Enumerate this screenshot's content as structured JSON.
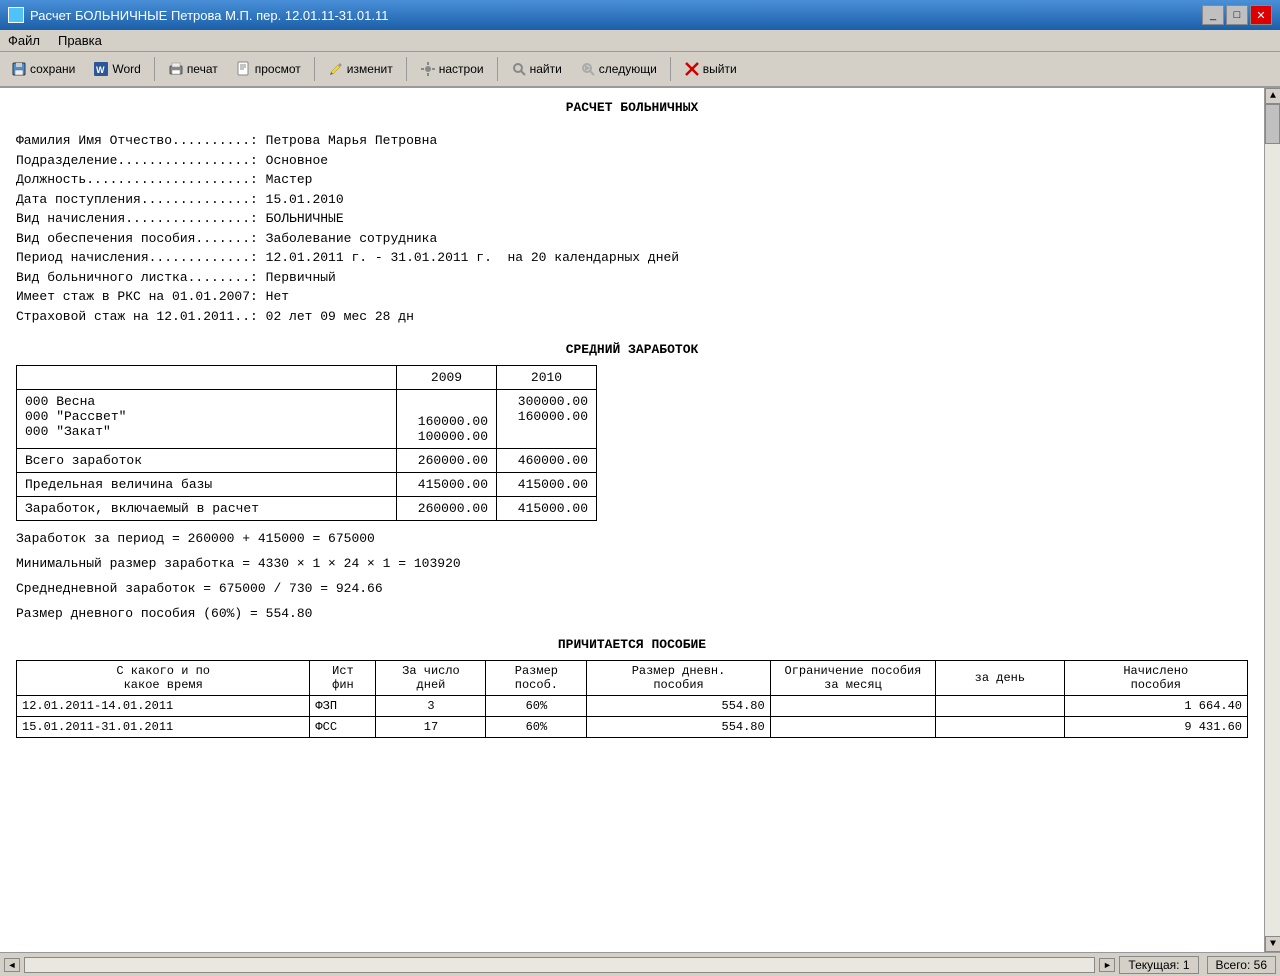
{
  "titleBar": {
    "title": "Расчет БОЛЬНИЧНЫЕ Петрова М.П. пер. 12.01.11-31.01.11",
    "icon": "app-icon"
  },
  "menuBar": {
    "items": [
      "Файл",
      "Правка"
    ]
  },
  "toolbar": {
    "buttons": [
      {
        "label": "сохрани",
        "icon": "save-icon"
      },
      {
        "label": "Word",
        "icon": "word-icon"
      },
      {
        "label": "печат",
        "icon": "print-icon"
      },
      {
        "label": "просмот",
        "icon": "preview-icon"
      },
      {
        "label": "изменит",
        "icon": "edit-icon"
      },
      {
        "label": "настрои",
        "icon": "settings-icon"
      },
      {
        "label": "найти",
        "icon": "find-icon"
      },
      {
        "label": "следующи",
        "icon": "next-icon"
      },
      {
        "label": "выйти",
        "icon": "exit-icon"
      }
    ]
  },
  "document": {
    "title": "РАСЧЕТ БОЛЬНИЧНЫХ",
    "infoLines": [
      {
        "label": "Фамилия Имя Отчество..........: ",
        "value": "Петрова Марья Петровна"
      },
      {
        "label": "Подразделение.................: ",
        "value": "Основное"
      },
      {
        "label": "Должность.....................: ",
        "value": "Мастер"
      },
      {
        "label": "Дата поступления..............: ",
        "value": "15.01.2010"
      },
      {
        "label": "Вид начисления................: ",
        "value": "БОЛЬНИЧНЫЕ"
      },
      {
        "label": "Вид обеспечения пособия.......: ",
        "value": "Заболевание сотрудника"
      },
      {
        "label": "Период начисления.............: ",
        "value": "12.01.2011 г. - 31.01.2011 г.  на 20 календарных дней"
      },
      {
        "label": "Вид больничного листка........: ",
        "value": "Первичный"
      },
      {
        "label": "Имеет стаж в РКС на 01.01.2007: ",
        "value": "Нет"
      },
      {
        "label": "Страховой стаж на 12.01.2011..: ",
        "value": "02 лет 09 мес 28 дн"
      }
    ],
    "avgEarningsTitle": "СРЕДНИЙ   ЗАРАБОТОК",
    "earningsTable": {
      "headers": [
        "",
        "2009",
        "2010"
      ],
      "rows": [
        {
          "name": "000 Весна",
          "y2009": "",
          "y2010": "300000.00"
        },
        {
          "name": "000 \"Рассвет\"",
          "y2009": "160000.00",
          "y2010": "160000.00"
        },
        {
          "name": "000 \"Закат\"",
          "y2009": "100000.00",
          "y2010": ""
        }
      ],
      "totals": [
        {
          "label": "Всего заработок",
          "y2009": "260000.00",
          "y2010": "460000.00"
        },
        {
          "label": "Предельная величина базы",
          "y2009": "415000.00",
          "y2010": "415000.00"
        },
        {
          "label": "Заработок, включаемый в расчет",
          "y2009": "260000.00",
          "y2010": "415000.00"
        }
      ]
    },
    "formulas": [
      "Заработок за период = 260000 + 415000 = 675000",
      "Минимальный размер заработка = 4330 × 1 × 24 × 1 = 103920",
      "Среднедневной заработок    = 675000 / 730 = 924.66",
      "Размер дневного пособия (60%) = 554.80"
    ],
    "benefitTitle": "ПРИЧИТАЕТСЯ ПОСОБИЕ",
    "benefitTable": {
      "headers": [
        "С какого и по\nкакое время",
        "Ист\nфин",
        "За число\nдней",
        "Размер\nпособ.",
        "Размер дневн.\nпособия",
        "Ограничение пособия\nза месяц    за день",
        "Начислено\nпособия"
      ],
      "rows": [
        {
          "period": "12.01.2011-14.01.2011",
          "fin": "ФЗП",
          "days": "3",
          "size": "60%",
          "daily": "554.80",
          "limit_month": "",
          "limit_day": "",
          "accrued": "1 664.40"
        },
        {
          "period": "15.01.2011-31.01.2011",
          "fin": "ФСС",
          "days": "17",
          "size": "60%",
          "daily": "554.80",
          "limit_month": "",
          "limit_day": "",
          "accrued": "9 431.60"
        }
      ]
    }
  },
  "statusBar": {
    "current": "Текущая: 1",
    "total": "Всего: 56"
  }
}
